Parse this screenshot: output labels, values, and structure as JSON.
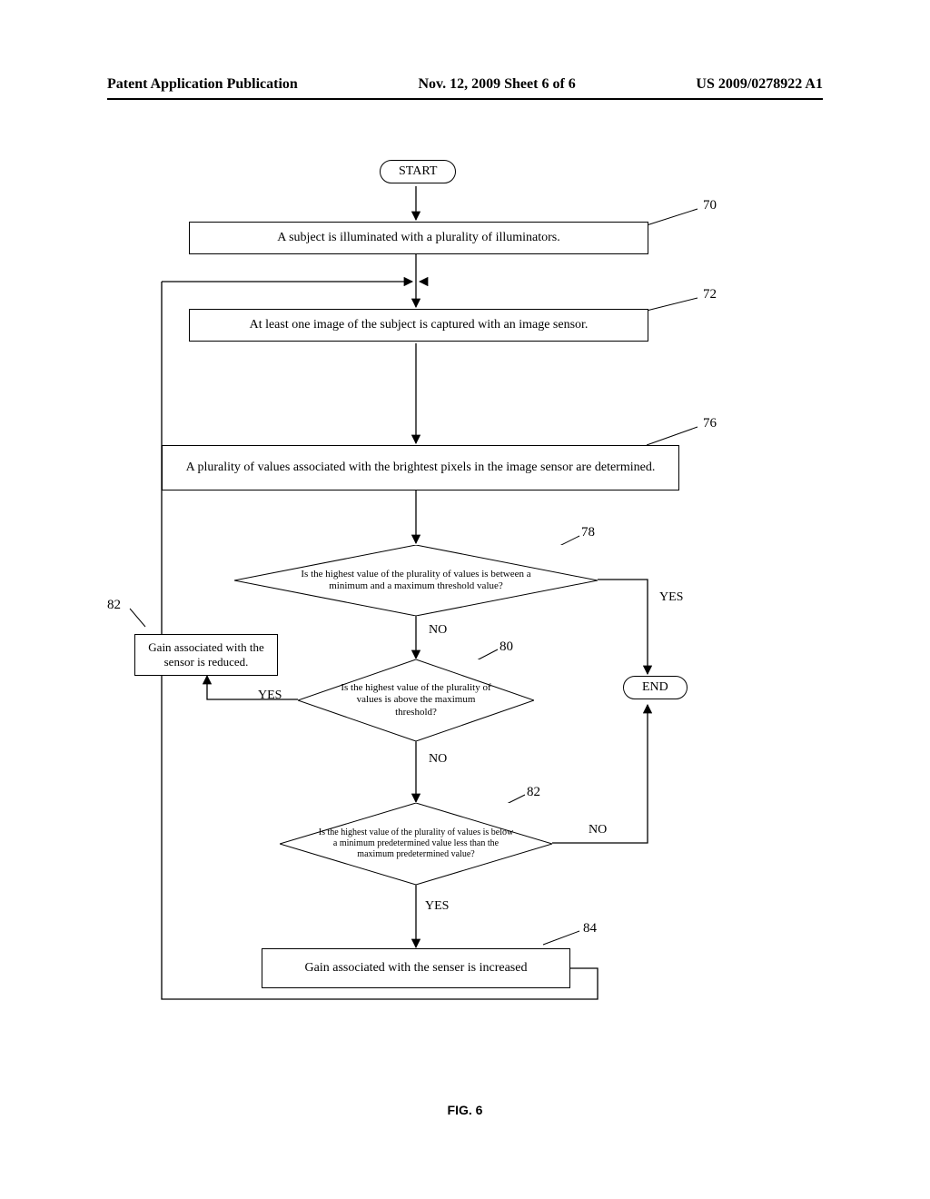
{
  "header": {
    "left": "Patent Application Publication",
    "mid": "Nov. 12, 2009  Sheet 6 of 6",
    "right": "US 2009/0278922 A1"
  },
  "flow": {
    "start": "START",
    "end": "END",
    "step70": "A subject is illuminated with a plurality of illuminators.",
    "step72": "At least one image of the subject is captured with an image sensor.",
    "step76": "A plurality of values associated with the brightest pixels in the image sensor are determined.",
    "dec78": "Is the highest value of the plurality of values is between a minimum and a maximum threshold value?",
    "dec80": "Is the highest value of the plurality of values is above the maximum threshold?",
    "dec82q": "Is the highest value of the plurality of values is below a minimum predetermined value less than the maximum predetermined value?",
    "reduceGain": "Gain associated with the sensor is reduced.",
    "increaseGain": "Gain associated with the senser is increased"
  },
  "labels": {
    "yes": "YES",
    "no": "NO"
  },
  "refs": {
    "r70": "70",
    "r72": "72",
    "r76": "76",
    "r78": "78",
    "r80": "80",
    "r82a": "82",
    "r82b": "82",
    "r84": "84"
  },
  "figure_caption": "FIG. 6",
  "chart_data": {
    "type": "flowchart",
    "nodes": [
      {
        "id": "start",
        "kind": "terminator",
        "label": "START"
      },
      {
        "id": "n70",
        "kind": "process",
        "ref": 70,
        "label": "A subject is illuminated with a plurality of illuminators."
      },
      {
        "id": "n72",
        "kind": "process",
        "ref": 72,
        "label": "At least one image of the subject is captured with an image sensor."
      },
      {
        "id": "n76",
        "kind": "process",
        "ref": 76,
        "label": "A plurality of values associated with the brightest pixels in the image sensor are determined."
      },
      {
        "id": "d78",
        "kind": "decision",
        "ref": 78,
        "label": "Is the highest value of the plurality of values is between a minimum and a maximum threshold value?"
      },
      {
        "id": "end",
        "kind": "terminator",
        "label": "END"
      },
      {
        "id": "d80",
        "kind": "decision",
        "ref": 80,
        "label": "Is the highest value of the plurality of values is above the maximum threshold?"
      },
      {
        "id": "n82reduce",
        "kind": "process",
        "ref": 82,
        "label": "Gain associated with the sensor is reduced."
      },
      {
        "id": "d82",
        "kind": "decision",
        "ref": 82,
        "label": "Is the highest value of the plurality of values is below a minimum predetermined value less than the maximum predetermined value?"
      },
      {
        "id": "n84",
        "kind": "process",
        "ref": 84,
        "label": "Gain associated with the senser is increased"
      }
    ],
    "edges": [
      {
        "from": "start",
        "to": "n70"
      },
      {
        "from": "n70",
        "to": "n72"
      },
      {
        "from": "n72",
        "to": "n76"
      },
      {
        "from": "n76",
        "to": "d78"
      },
      {
        "from": "d78",
        "to": "end",
        "label": "YES"
      },
      {
        "from": "d78",
        "to": "d80",
        "label": "NO"
      },
      {
        "from": "d80",
        "to": "n82reduce",
        "label": "YES"
      },
      {
        "from": "n82reduce",
        "to": "n72"
      },
      {
        "from": "d80",
        "to": "d82",
        "label": "NO"
      },
      {
        "from": "d82",
        "to": "end",
        "label": "NO"
      },
      {
        "from": "d82",
        "to": "n84",
        "label": "YES"
      },
      {
        "from": "n84",
        "to": "n72"
      }
    ]
  }
}
